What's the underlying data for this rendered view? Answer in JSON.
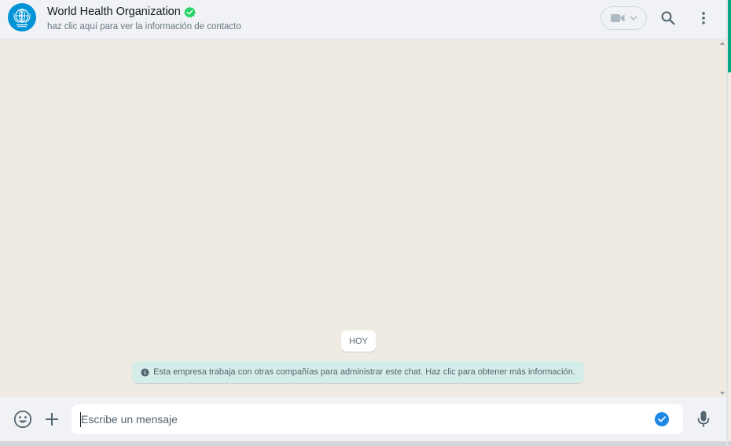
{
  "header": {
    "contact_name": "World Health Organization",
    "contact_subtitle": "haz clic aquí para ver la información de contacto",
    "avatar_icon": "who-logo-icon",
    "verified_icon": "verified-check-icon",
    "video_icon": "video-camera-icon",
    "search_icon": "search-icon",
    "menu_icon": "vertical-dots-icon"
  },
  "chat": {
    "date_label": "HOY",
    "system_message": "Esta empresa trabaja con otras compañías para administrar este chat. Haz clic para obtener más información."
  },
  "composer": {
    "placeholder": "Escribe un mensaje",
    "value": ""
  },
  "colors": {
    "accent": "#00a884",
    "verified": "#25d366",
    "system_bg": "#d4ede8",
    "chat_bg": "#efeae2",
    "header_bg": "#f0f2f5",
    "check_blue": "#1e88e5",
    "avatar_bg": "#0093d5"
  }
}
